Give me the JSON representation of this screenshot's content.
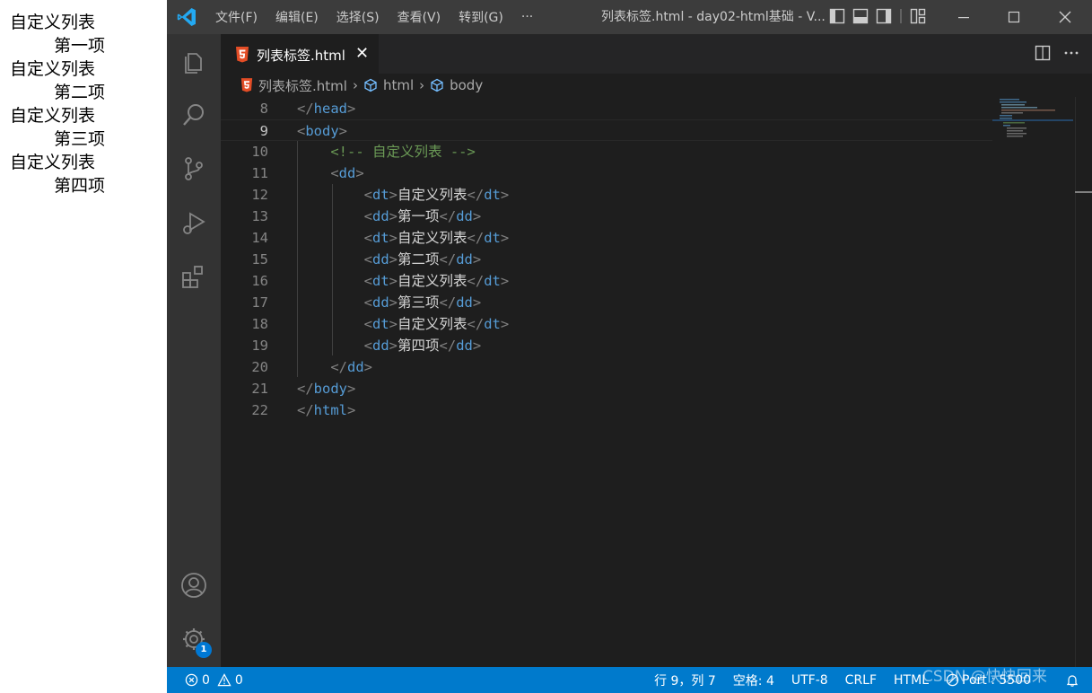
{
  "preview": {
    "items": [
      {
        "dt": "自定义列表",
        "dd": "第一项"
      },
      {
        "dt": "自定义列表",
        "dd": "第二项"
      },
      {
        "dt": "自定义列表",
        "dd": "第三项"
      },
      {
        "dt": "自定义列表",
        "dd": "第四项"
      }
    ]
  },
  "titlebar": {
    "menus": [
      "文件(F)",
      "编辑(E)",
      "选择(S)",
      "查看(V)",
      "转到(G)",
      "···"
    ],
    "title": "列表标签.html - day02-html基础 - V..."
  },
  "tab": {
    "label": "列表标签.html",
    "close": "✕"
  },
  "breadcrumb": {
    "file": "列表标签.html",
    "html": "html",
    "body": "body",
    "sep": "›"
  },
  "editor": {
    "active_line": 9,
    "lines": [
      {
        "n": "8",
        "indent": "",
        "tokens": [
          [
            "t-punc",
            "</"
          ],
          [
            "t-tag",
            "head"
          ],
          [
            "t-punc",
            ">"
          ]
        ]
      },
      {
        "n": "9",
        "indent": "",
        "tokens": [
          [
            "t-punc",
            "<"
          ],
          [
            "t-tag",
            "body"
          ],
          [
            "t-punc",
            ">"
          ]
        ]
      },
      {
        "n": "10",
        "indent": "    ",
        "tokens": [
          [
            "t-cmt",
            "<!-- 自定义列表 -->"
          ]
        ]
      },
      {
        "n": "11",
        "indent": "    ",
        "tokens": [
          [
            "t-punc",
            "<"
          ],
          [
            "t-tag",
            "dd"
          ],
          [
            "t-punc",
            ">"
          ]
        ]
      },
      {
        "n": "12",
        "indent": "        ",
        "tokens": [
          [
            "t-punc",
            "<"
          ],
          [
            "t-tag",
            "dt"
          ],
          [
            "t-punc",
            ">"
          ],
          [
            "t-text",
            "自定义列表"
          ],
          [
            "t-punc",
            "</"
          ],
          [
            "t-tag",
            "dt"
          ],
          [
            "t-punc",
            ">"
          ]
        ]
      },
      {
        "n": "13",
        "indent": "        ",
        "tokens": [
          [
            "t-punc",
            "<"
          ],
          [
            "t-tag",
            "dd"
          ],
          [
            "t-punc",
            ">"
          ],
          [
            "t-text",
            "第一项"
          ],
          [
            "t-punc",
            "</"
          ],
          [
            "t-tag",
            "dd"
          ],
          [
            "t-punc",
            ">"
          ]
        ]
      },
      {
        "n": "14",
        "indent": "        ",
        "tokens": [
          [
            "t-punc",
            "<"
          ],
          [
            "t-tag",
            "dt"
          ],
          [
            "t-punc",
            ">"
          ],
          [
            "t-text",
            "自定义列表"
          ],
          [
            "t-punc",
            "</"
          ],
          [
            "t-tag",
            "dt"
          ],
          [
            "t-punc",
            ">"
          ]
        ]
      },
      {
        "n": "15",
        "indent": "        ",
        "tokens": [
          [
            "t-punc",
            "<"
          ],
          [
            "t-tag",
            "dd"
          ],
          [
            "t-punc",
            ">"
          ],
          [
            "t-text",
            "第二项"
          ],
          [
            "t-punc",
            "</"
          ],
          [
            "t-tag",
            "dd"
          ],
          [
            "t-punc",
            ">"
          ]
        ]
      },
      {
        "n": "16",
        "indent": "        ",
        "tokens": [
          [
            "t-punc",
            "<"
          ],
          [
            "t-tag",
            "dt"
          ],
          [
            "t-punc",
            ">"
          ],
          [
            "t-text",
            "自定义列表"
          ],
          [
            "t-punc",
            "</"
          ],
          [
            "t-tag",
            "dt"
          ],
          [
            "t-punc",
            ">"
          ]
        ]
      },
      {
        "n": "17",
        "indent": "        ",
        "tokens": [
          [
            "t-punc",
            "<"
          ],
          [
            "t-tag",
            "dd"
          ],
          [
            "t-punc",
            ">"
          ],
          [
            "t-text",
            "第三项"
          ],
          [
            "t-punc",
            "</"
          ],
          [
            "t-tag",
            "dd"
          ],
          [
            "t-punc",
            ">"
          ]
        ]
      },
      {
        "n": "18",
        "indent": "        ",
        "tokens": [
          [
            "t-punc",
            "<"
          ],
          [
            "t-tag",
            "dt"
          ],
          [
            "t-punc",
            ">"
          ],
          [
            "t-text",
            "自定义列表"
          ],
          [
            "t-punc",
            "</"
          ],
          [
            "t-tag",
            "dt"
          ],
          [
            "t-punc",
            ">"
          ]
        ]
      },
      {
        "n": "19",
        "indent": "        ",
        "tokens": [
          [
            "t-punc",
            "<"
          ],
          [
            "t-tag",
            "dd"
          ],
          [
            "t-punc",
            ">"
          ],
          [
            "t-text",
            "第四项"
          ],
          [
            "t-punc",
            "</"
          ],
          [
            "t-tag",
            "dd"
          ],
          [
            "t-punc",
            ">"
          ]
        ]
      },
      {
        "n": "20",
        "indent": "    ",
        "tokens": [
          [
            "t-punc",
            "</"
          ],
          [
            "t-tag",
            "dd"
          ],
          [
            "t-punc",
            ">"
          ]
        ]
      },
      {
        "n": "21",
        "indent": "",
        "tokens": [
          [
            "t-punc",
            "</"
          ],
          [
            "t-tag",
            "body"
          ],
          [
            "t-punc",
            ">"
          ]
        ]
      },
      {
        "n": "22",
        "indent": "",
        "tokens": [
          [
            "t-punc",
            "</"
          ],
          [
            "t-tag",
            "html"
          ],
          [
            "t-punc",
            ">"
          ]
        ]
      }
    ]
  },
  "activity": {
    "notification_count": "1"
  },
  "status": {
    "errors": "0",
    "warnings": "0",
    "position": "行 9，列 7",
    "spaces": "空格: 4",
    "encoding": "UTF-8",
    "eol": "CRLF",
    "language": "HTML",
    "port": "Port : 5500"
  },
  "watermark": "CSDN @快快回来",
  "colors": {
    "accent": "#007acc",
    "tag": "#569cd6",
    "comment": "#6a9955",
    "html5": "#e44d26"
  }
}
